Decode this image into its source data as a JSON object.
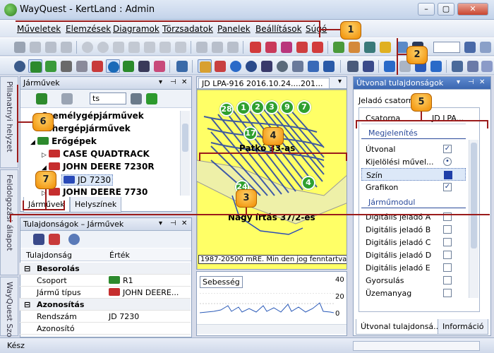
{
  "window": {
    "title": "WayQuest - KertLand : Admin",
    "minimize": "–",
    "maximize": "▢",
    "close": "✕"
  },
  "menu": [
    "Műveletek",
    "Elemzések",
    "Diagramok",
    "Törzsadatok",
    "Panelek",
    "Beállítások",
    "Súgó"
  ],
  "side_tabs": {
    "top": "Pillanatnyi helyzet",
    "middle": "Feldolgozási állapot",
    "bottom": "WayQuest Szol"
  },
  "vehicles_panel": {
    "title": "Járművek",
    "search_value": "ts",
    "tree": [
      {
        "label": "Személygépjárművek",
        "level": 0,
        "bold": true
      },
      {
        "label": "Tehergépjárművek",
        "level": 0,
        "bold": true
      },
      {
        "label": "Erőgépek",
        "level": 0,
        "bold": true
      },
      {
        "label": "CASE QUADTRACK",
        "level": 1,
        "bold": true
      },
      {
        "label": "JOHN DEERE 7230R",
        "level": 1,
        "bold": true
      },
      {
        "label": "JD 7230",
        "level": 2,
        "bold": false
      },
      {
        "label": "JOHN DEERE 7730",
        "level": 1,
        "bold": true
      }
    ],
    "tabs": [
      "Járművek",
      "Helyszínek"
    ]
  },
  "properties_panel": {
    "title": "Tulajdonságok – Járművek",
    "columns": [
      "Tulajdonság",
      "Érték"
    ],
    "rows": [
      {
        "type": "category",
        "label": "Besorolás"
      },
      {
        "type": "prop",
        "label": "Csoport",
        "value": "R1"
      },
      {
        "type": "prop",
        "label": "Jármű típus",
        "value": "JOHN DEERE..."
      },
      {
        "type": "category",
        "label": "Azonosítás"
      },
      {
        "type": "prop",
        "label": "Rendszám",
        "value": "JD 7230"
      },
      {
        "type": "prop",
        "label": "Azonosító",
        "value": ""
      }
    ]
  },
  "map": {
    "tab_label": "JD LPA-916 2016.10.24....201...",
    "field_labels": [
      "Patkó 33-as",
      "Nagy írtás 37/2-es"
    ],
    "markers": [
      "28",
      "1",
      "2",
      "3",
      "9",
      "7",
      "17",
      "24",
      "4"
    ],
    "copyright": "1987-20500 mRE. Min den jog fenntartva.",
    "speed_label": "Sebesség",
    "speed_ticks": [
      "40",
      "20",
      "0"
    ]
  },
  "route_panel": {
    "title": "Útvonal tulajdonságok",
    "sender_label": "Jeladó csatorna",
    "col_key": "Csatorna",
    "col_val": "JD LPA...",
    "section1": "Megjelenítés",
    "items1": [
      {
        "label": "Útvonal",
        "control": "check",
        "state": "✓"
      },
      {
        "label": "Kijelölési művel...",
        "control": "radio",
        "state": "•"
      },
      {
        "label": "Szín",
        "control": "color",
        "state": ""
      },
      {
        "label": "Grafikon",
        "control": "check",
        "state": "✓"
      }
    ],
    "section2": "Járműmodul",
    "items2": [
      "Digitális jeladó A",
      "Digitális jeladó B",
      "Digitális jeladó C",
      "Digitális jeladó D",
      "Digitális jeladó E",
      "Gyorsulás",
      "Üzemanyag"
    ],
    "tabs": [
      "Útvonal tulajdonsá...",
      "Információ"
    ]
  },
  "callouts": [
    "1",
    "2",
    "3",
    "4",
    "5",
    "6",
    "7"
  ],
  "status": "Kész",
  "colors": {
    "accent": "#f08c00",
    "field": "#ffff66",
    "track": "#1f3fa8",
    "marker": "#2fa02f",
    "callout_line": "#9b1b1b"
  }
}
